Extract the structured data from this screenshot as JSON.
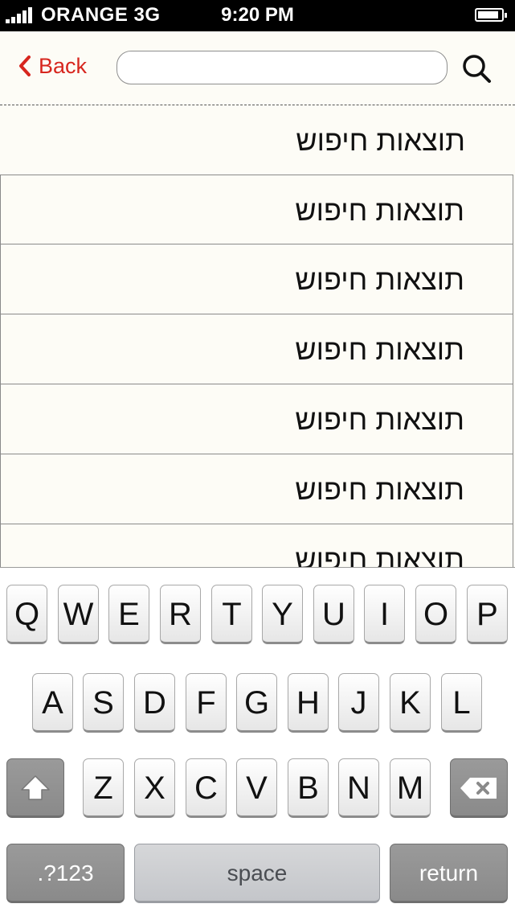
{
  "status_bar": {
    "carrier": "ORANGE 3G",
    "time": "9:20 PM",
    "battery_level": 0.9
  },
  "header": {
    "back_label": "Back",
    "search_value": "",
    "search_placeholder": ""
  },
  "results": [
    {
      "label": "תוצאות חיפוש"
    },
    {
      "label": "תוצאות חיפוש"
    },
    {
      "label": "תוצאות חיפוש"
    },
    {
      "label": "תוצאות חיפוש"
    },
    {
      "label": "תוצאות חיפוש"
    },
    {
      "label": "תוצאות חיפוש"
    },
    {
      "label": "תוצאות חיפוש"
    }
  ],
  "keyboard": {
    "row1": [
      "Q",
      "W",
      "E",
      "R",
      "T",
      "Y",
      "U",
      "I",
      "O",
      "P"
    ],
    "row2": [
      "A",
      "S",
      "D",
      "F",
      "G",
      "H",
      "J",
      "K",
      "L"
    ],
    "row3": [
      "Z",
      "X",
      "C",
      "V",
      "B",
      "N",
      "M"
    ],
    "numbers_label": ".?123",
    "space_label": "space",
    "return_label": "return"
  },
  "colors": {
    "accent": "#d7261e",
    "background": "#fdfcf6"
  }
}
